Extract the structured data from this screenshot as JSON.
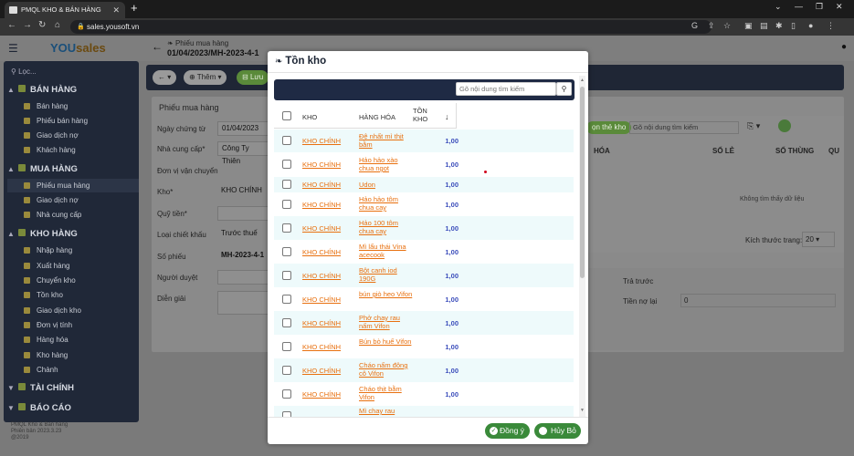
{
  "browser": {
    "tab_title": "PMQL KHO & BÁN HÀNG",
    "url": "sales.yousoft.vn"
  },
  "app": {
    "logo_prefix": "YOU",
    "logo_suffix": "sales",
    "breadcrumb": "Phiếu mua hàng",
    "doc_title": "01/04/2023/MH-2023-4-1",
    "search_placeholder": "Lọc...",
    "footer_line1": "PMQL Kho & Bán hàng",
    "footer_line2": "Phiên bản 2023.3.23",
    "footer_line3": "@2019"
  },
  "sidebar": {
    "groups": [
      {
        "label": "BÁN HÀNG",
        "items": [
          "Bán hàng",
          "Phiếu bán hàng",
          "Giao dịch nợ",
          "Khách hàng"
        ]
      },
      {
        "label": "MUA HÀNG",
        "items": [
          "Phiếu mua hàng",
          "Giao dịch nợ",
          "Nhà cung cấp"
        ]
      },
      {
        "label": "KHO HÀNG",
        "items": [
          "Nhập hàng",
          "Xuất hàng",
          "Chuyển kho",
          "Tồn kho",
          "Giao dịch kho",
          "Đơn vị tính",
          "Hàng hóa",
          "Kho hàng",
          "Chành"
        ]
      },
      {
        "label": "TÀI CHÍNH",
        "items": []
      },
      {
        "label": "BÁO CÁO",
        "items": []
      }
    ]
  },
  "toolbar": {
    "add_label": "Thêm",
    "save_label": "Lưu",
    "right_btn_label": "ọn thẻ kho",
    "right_search_placeholder": "Gõ nội dung tìm kiếm"
  },
  "form": {
    "title": "Phiếu mua hàng",
    "fields": [
      {
        "label": "Ngày chứng từ",
        "value": "01/04/2023"
      },
      {
        "label": "Nhà cung cấp*",
        "value": "Công Ty Thiên"
      },
      {
        "label": "Đơn vị vận chuyển",
        "value": ""
      },
      {
        "label": "Kho*",
        "value": "KHO CHÍNH"
      },
      {
        "label": "Quỹ tiền*",
        "value": ""
      },
      {
        "label": "Loại chiết khấu",
        "value": "Trước thuế"
      },
      {
        "label": "Số phiếu",
        "value": "MH-2023-4-1"
      },
      {
        "label": "Người duyệt",
        "value": ""
      },
      {
        "label": "Diễn giải",
        "value": ""
      }
    ]
  },
  "bg_table": {
    "col_hang_hoa": "HÓA",
    "col_so_le": "SỐ LẺ",
    "col_so_thung": "SỐ THÙNG",
    "col_qu": "QU",
    "empty_text": "Không tìm thấy dữ liệu",
    "page_size_label": "Kích thước trang:",
    "page_size_value": "20"
  },
  "bg_summary": {
    "tra_truoc_label": "Trả trước",
    "tien_no_lai_label": "Tiền nợ lại",
    "tien_no_lai_value": "0"
  },
  "modal": {
    "title": "Tồn kho",
    "search_placeholder": "Gõ nội dung tìm kiếm",
    "columns": {
      "kho": "KHO",
      "hang_hoa": "HÀNG HÓA",
      "ton_kho": "TỒN KHO",
      "sort": "↓"
    },
    "rows": [
      {
        "kho": "KHO CHÍNH",
        "hang": "Đệ nhất mì thịt bằm",
        "ton": "1,00"
      },
      {
        "kho": "KHO CHÍNH",
        "hang": "Hảo hảo xào chua ngọt",
        "ton": "1,00"
      },
      {
        "kho": "KHO CHÍNH",
        "hang": "Udon",
        "ton": "1,00"
      },
      {
        "kho": "KHO CHÍNH",
        "hang": "Hảo hảo tôm chua cay",
        "ton": "1,00"
      },
      {
        "kho": "KHO CHÍNH",
        "hang": "Hảo 100 tôm chua cay",
        "ton": "1,00"
      },
      {
        "kho": "KHO CHÍNH",
        "hang": "Mì lẩu thái Vina acecook",
        "ton": "1,00"
      },
      {
        "kho": "KHO CHÍNH",
        "hang": "Bột canh iod 190G",
        "ton": "1,00"
      },
      {
        "kho": "KHO CHÍNH",
        "hang": "bún giò heo Vifon",
        "ton": "1,00"
      },
      {
        "kho": "KHO CHÍNH",
        "hang": "Phở chay rau nấm Vifon",
        "ton": "1,00"
      },
      {
        "kho": "KHO CHÍNH",
        "hang": "Bún bò huế Vifon",
        "ton": "1,00"
      },
      {
        "kho": "KHO CHÍNH",
        "hang": "Cháo nấm đông cô Vifon",
        "ton": "1,00"
      },
      {
        "kho": "KHO CHÍNH",
        "hang": "Cháo thịt bằm Vifon",
        "ton": "1,00"
      },
      {
        "kho": "",
        "hang": "Mì chay rau",
        "ton": ""
      }
    ],
    "ok_label": "Đồng ý",
    "cancel_label": "Hủy Bỏ"
  },
  "colors": {
    "accent_green": "#3a8a3a",
    "link_orange": "#e8700f",
    "value_blue": "#3b4dbb",
    "dark_navy": "#1f2a44"
  }
}
